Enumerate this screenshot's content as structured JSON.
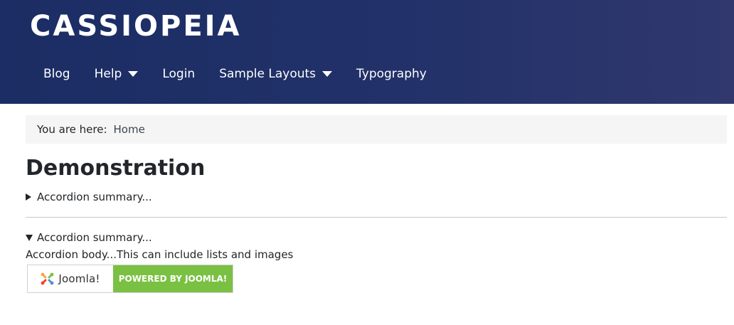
{
  "site": {
    "brand": "CASSIOPEIA"
  },
  "nav": {
    "items": [
      {
        "label": "Blog",
        "has_dropdown": false
      },
      {
        "label": "Help",
        "has_dropdown": true
      },
      {
        "label": "Login",
        "has_dropdown": false
      },
      {
        "label": "Sample Layouts",
        "has_dropdown": true
      },
      {
        "label": "Typography",
        "has_dropdown": false
      }
    ]
  },
  "breadcrumb": {
    "label": "You are here:",
    "home": "Home"
  },
  "main": {
    "title": "Demonstration",
    "accordions": [
      {
        "summary": "Accordion summary...",
        "open": false
      },
      {
        "summary": "Accordion summary...",
        "open": true,
        "body": "Accordion body...This can include lists and images"
      }
    ]
  },
  "badge": {
    "logo_text": "Joomla!",
    "powered_text": "POWERED BY JOOMLA!",
    "icon": "joomla-logo-icon"
  },
  "colors": {
    "header_bg": "#1b2d64",
    "header_bg_end": "#30386e",
    "breadcrumb_bg": "#f5f5f5",
    "badge_green": "#7ac143",
    "logo_red": "#f44321",
    "logo_orange": "#f9a541",
    "logo_green": "#7ac143",
    "logo_blue": "#5091cd"
  }
}
